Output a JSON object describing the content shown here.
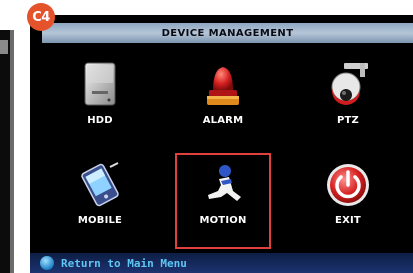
{
  "badge": "C4",
  "screen": {
    "title": "DEVICE MANAGEMENT",
    "menu": [
      {
        "label": "HDD",
        "icon": "hdd-icon"
      },
      {
        "label": "ALARM",
        "icon": "alarm-icon"
      },
      {
        "label": "PTZ",
        "icon": "ptz-camera-icon"
      },
      {
        "label": "MOBILE",
        "icon": "mobile-icon"
      },
      {
        "label": "MOTION",
        "icon": "motion-icon",
        "selected": true
      },
      {
        "label": "EXIT",
        "icon": "exit-power-icon"
      }
    ],
    "footer": {
      "text": "Return to Main Menu",
      "icon": "info-icon"
    }
  },
  "colors": {
    "screen_bg": "#000000",
    "title_bar": "#a9bcd1",
    "selection_outline": "#e0413e",
    "footer_text": "#5ec6f4",
    "badge": "#e4532c"
  }
}
